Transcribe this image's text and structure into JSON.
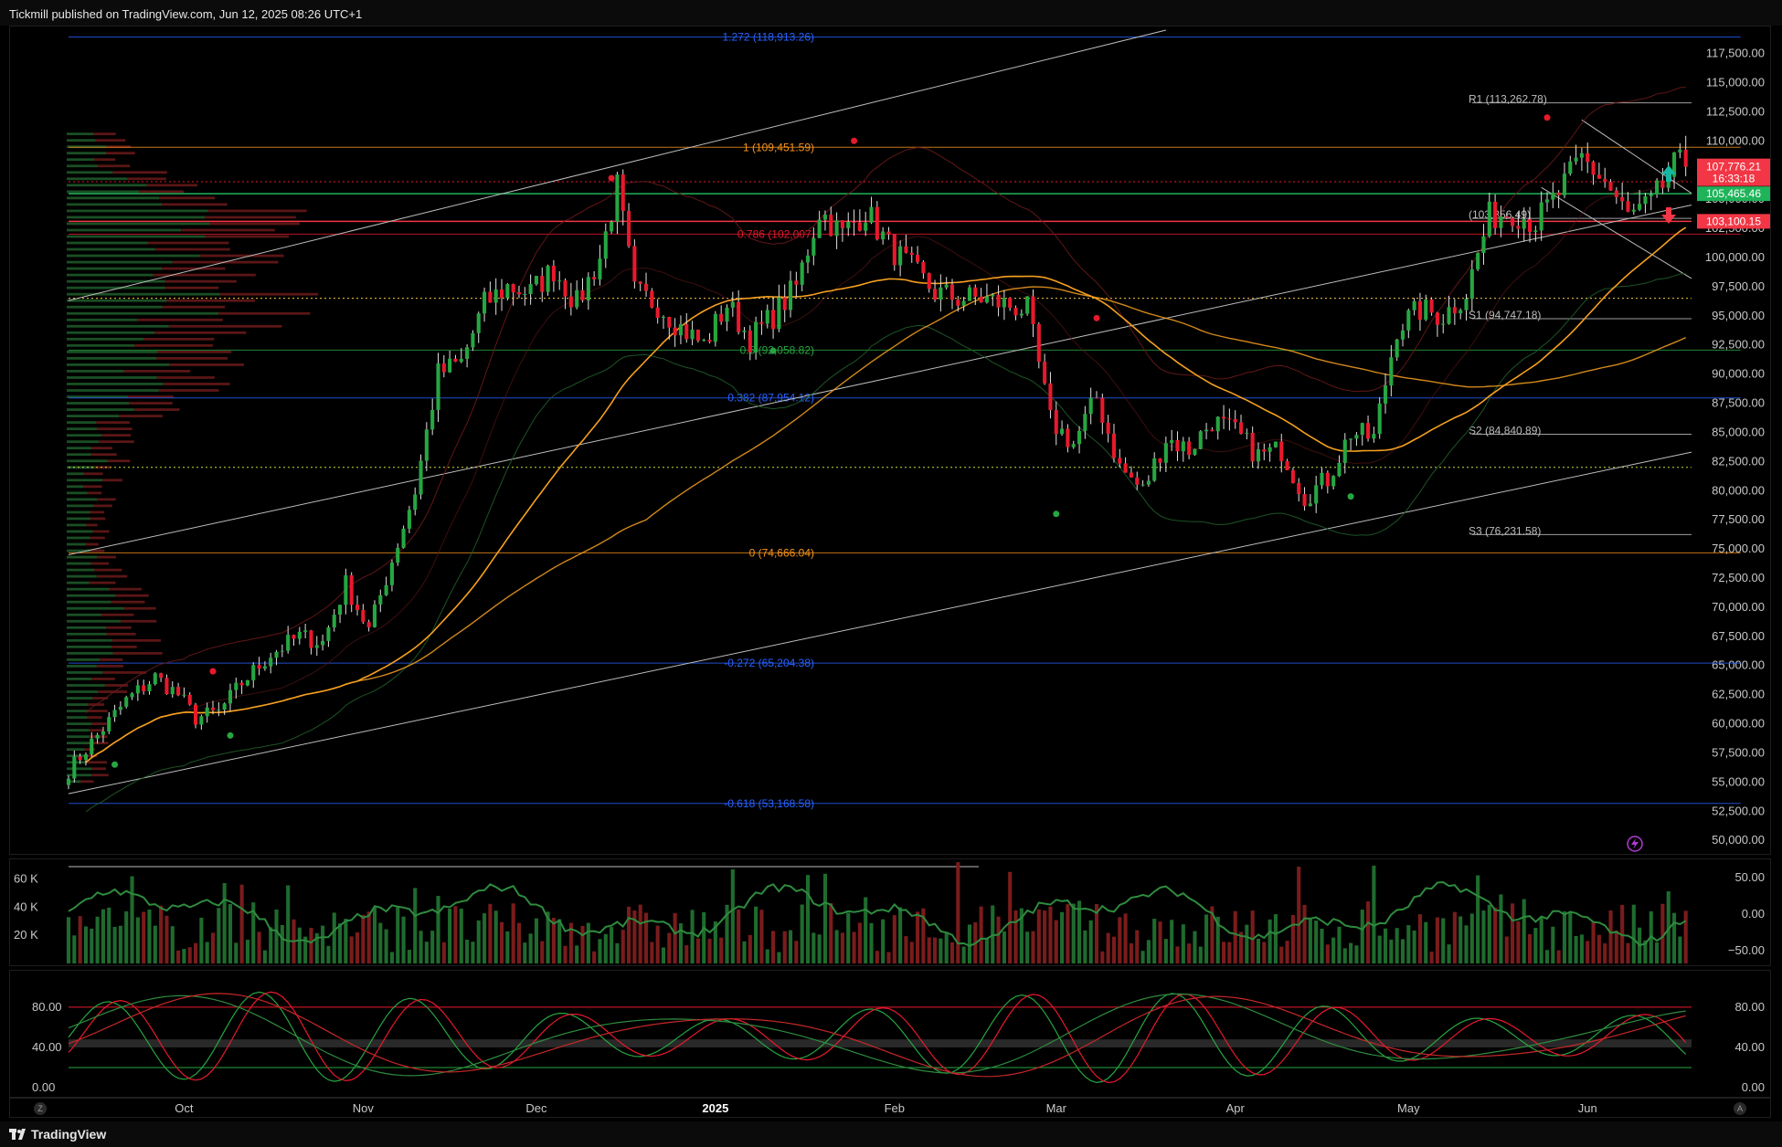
{
  "header": {
    "published": "Tickmill published on TradingView.com, Jun 12, 2025 08:26 UTC+1"
  },
  "footer": {
    "brand": "TradingView"
  },
  "corner_buttons": {
    "left": "Z",
    "right": "A"
  },
  "colors": {
    "up": "#26a641",
    "down": "#e8192c",
    "fib_orange": "#f7931a",
    "fib_blue": "#2962ff",
    "ma_orange": "#f6a020",
    "channel": "#9e9e9e",
    "price_label": "#f23645",
    "green_label": "#1fb35a"
  },
  "chart_data": [
    {
      "type": "candlestick",
      "id": "price",
      "ylim": [
        49000,
        119500
      ],
      "ytick_values": [
        50000,
        52500,
        55000,
        57500,
        60000,
        62500,
        65000,
        67500,
        70000,
        72500,
        75000,
        77500,
        80000,
        82500,
        85000,
        87500,
        90000,
        92500,
        95000,
        97500,
        100000,
        102500,
        105000,
        107500,
        110000,
        112500,
        115000,
        117500
      ],
      "ytick_labels": [
        "50,000.00",
        "52,500.00",
        "55,000.00",
        "57,500.00",
        "60,000.00",
        "62,500.00",
        "65,000.00",
        "67,500.00",
        "70,000.00",
        "72,500.00",
        "75,000.00",
        "77,500.00",
        "80,000.00",
        "82,500.00",
        "85,000.00",
        "87,500.00",
        "90,000.00",
        "92,500.00",
        "95,000.00",
        "97,500.00",
        "100,000.00",
        "102,500.00",
        "105,000.00",
        "107,500.00",
        "110,000.00",
        "112,500.00",
        "115,000.00",
        "117,500.00"
      ],
      "x_tick_labels": [
        "Oct",
        "Nov",
        "Dec",
        "2025",
        "Feb",
        "Mar",
        "Apr",
        "May",
        "Jun"
      ],
      "x_tick_days": [
        20,
        51,
        81,
        112,
        143,
        171,
        202,
        232,
        263
      ],
      "days_total": 281,
      "close_anchors": [
        [
          0,
          56000
        ],
        [
          5,
          59000
        ],
        [
          10,
          62000
        ],
        [
          15,
          64000
        ],
        [
          19,
          62500
        ],
        [
          22,
          60500
        ],
        [
          26,
          61000
        ],
        [
          30,
          63500
        ],
        [
          35,
          66000
        ],
        [
          40,
          67500
        ],
        [
          44,
          67000
        ],
        [
          48,
          72000
        ],
        [
          52,
          68000
        ],
        [
          56,
          74000
        ],
        [
          60,
          80000
        ],
        [
          64,
          90000
        ],
        [
          68,
          91000
        ],
        [
          72,
          96000
        ],
        [
          76,
          97500
        ],
        [
          80,
          97000
        ],
        [
          84,
          99000
        ],
        [
          88,
          96000
        ],
        [
          92,
          100000
        ],
        [
          95,
          106000
        ],
        [
          98,
          97000
        ],
        [
          102,
          96000
        ],
        [
          106,
          94000
        ],
        [
          110,
          92500
        ],
        [
          114,
          96000
        ],
        [
          118,
          93000
        ],
        [
          122,
          95000
        ],
        [
          126,
          97500
        ],
        [
          130,
          104000
        ],
        [
          134,
          102000
        ],
        [
          138,
          104000
        ],
        [
          142,
          101000
        ],
        [
          146,
          99000
        ],
        [
          150,
          97000
        ],
        [
          154,
          96500
        ],
        [
          158,
          96500
        ],
        [
          162,
          96000
        ],
        [
          166,
          95500
        ],
        [
          170,
          86000
        ],
        [
          174,
          84000
        ],
        [
          178,
          88000
        ],
        [
          182,
          82000
        ],
        [
          186,
          80000
        ],
        [
          190,
          84500
        ],
        [
          194,
          83500
        ],
        [
          198,
          86000
        ],
        [
          202,
          85000
        ],
        [
          206,
          83000
        ],
        [
          210,
          83500
        ],
        [
          214,
          79500
        ],
        [
          218,
          81000
        ],
        [
          222,
          85000
        ],
        [
          226,
          84500
        ],
        [
          230,
          94000
        ],
        [
          234,
          95500
        ],
        [
          238,
          95000
        ],
        [
          242,
          97000
        ],
        [
          246,
          103500
        ],
        [
          250,
          104000
        ],
        [
          254,
          103000
        ],
        [
          258,
          105500
        ],
        [
          262,
          108500
        ],
        [
          266,
          106500
        ],
        [
          270,
          103500
        ],
        [
          274,
          104500
        ],
        [
          278,
          107776
        ]
      ],
      "last_price": "107,776.21",
      "countdown": "16:33:18",
      "green_level": "105,465.46",
      "red_level": "103,100.15",
      "fib_levels": [
        {
          "label": "1.272 (118,913.26)",
          "value": 118913.26,
          "color": "#2962ff"
        },
        {
          "label": "1 (109,451.59)",
          "value": 109451.59,
          "color": "#f7931a"
        },
        {
          "label": "0.786 (102,007.",
          "value": 102007,
          "color": "#e8192c"
        },
        {
          "label": "0.5 (92,058.82)",
          "value": 92058.82,
          "color": "#26a641"
        },
        {
          "label": "0.382 (87,954.12)",
          "value": 87954.12,
          "color": "#2962ff"
        },
        {
          "label": "0 (74,666.04)",
          "value": 74666.04,
          "color": "#f7931a"
        },
        {
          "label": "-0.272 (65,204.38)",
          "value": 65204.38,
          "color": "#2962ff"
        },
        {
          "label": "-0.618 (53,168.58)",
          "value": 53168.58,
          "color": "#2962ff"
        }
      ],
      "pivot_levels": [
        {
          "label": "R1 (113,262.78)",
          "value": 113262.78
        },
        {
          "label": "(103,356.49)",
          "value": 103356.49
        },
        {
          "label": "S1 (94,747.18)",
          "value": 94747.18
        },
        {
          "label": "S2 (84,840.89)",
          "value": 84840.89
        },
        {
          "label": "S3 (76,231.58)",
          "value": 76231.58
        }
      ]
    },
    {
      "type": "bar",
      "id": "volume",
      "left_tick_labels": [
        "60 K",
        "40 K",
        "20 K"
      ],
      "left_tick_values": [
        60000,
        40000,
        20000
      ],
      "right_tick_labels": [
        "50.00",
        "0.00",
        "−50.00"
      ],
      "right_tick_values": [
        50,
        0,
        -50
      ]
    },
    {
      "type": "line",
      "id": "stochastic",
      "ylim": [
        0,
        100
      ],
      "right_tick_labels": [
        "80.00",
        "40.00",
        "0.00"
      ],
      "left_tick_labels": [
        "80.00",
        "40.00",
        "0.00"
      ],
      "tick_values": [
        80,
        40,
        0
      ]
    }
  ]
}
